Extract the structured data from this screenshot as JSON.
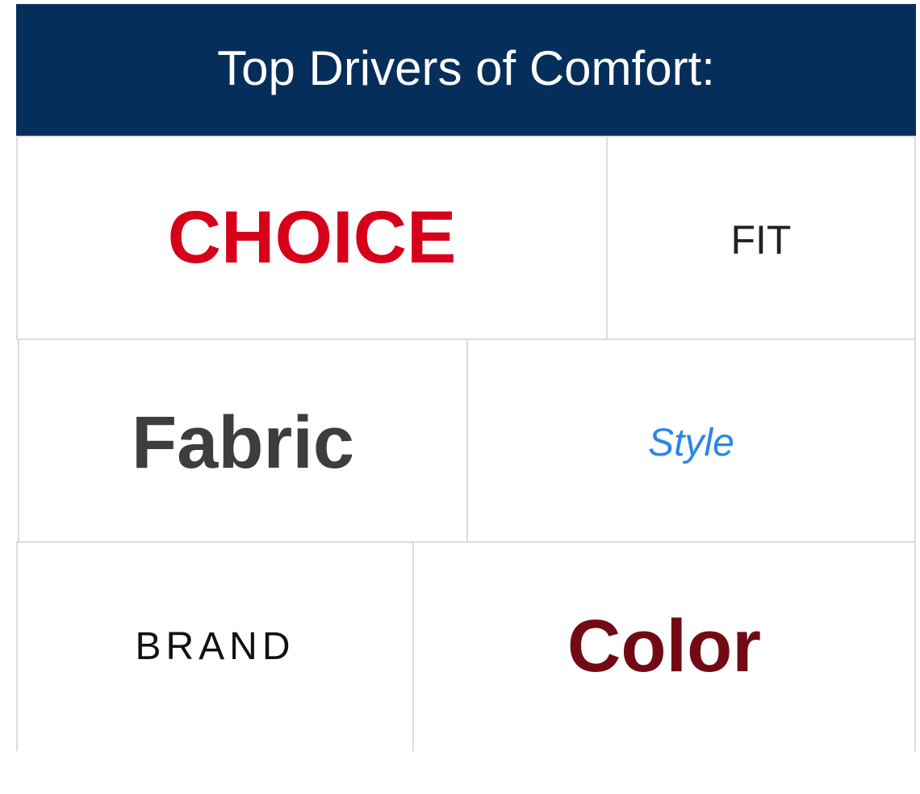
{
  "header": {
    "title": "Top Drivers of Comfort:"
  },
  "drivers": {
    "choice": "CHOICE",
    "fit": "FIT",
    "fabric": "Fabric",
    "style": "Style",
    "brand": "BRAND",
    "color": "Color"
  },
  "colors": {
    "header_bg": "#052e5b",
    "choice": "#d7001a",
    "fabric": "#3d3d3d",
    "style": "#2b86e6",
    "color": "#720a14",
    "cell_border": "#dcdcdc"
  }
}
